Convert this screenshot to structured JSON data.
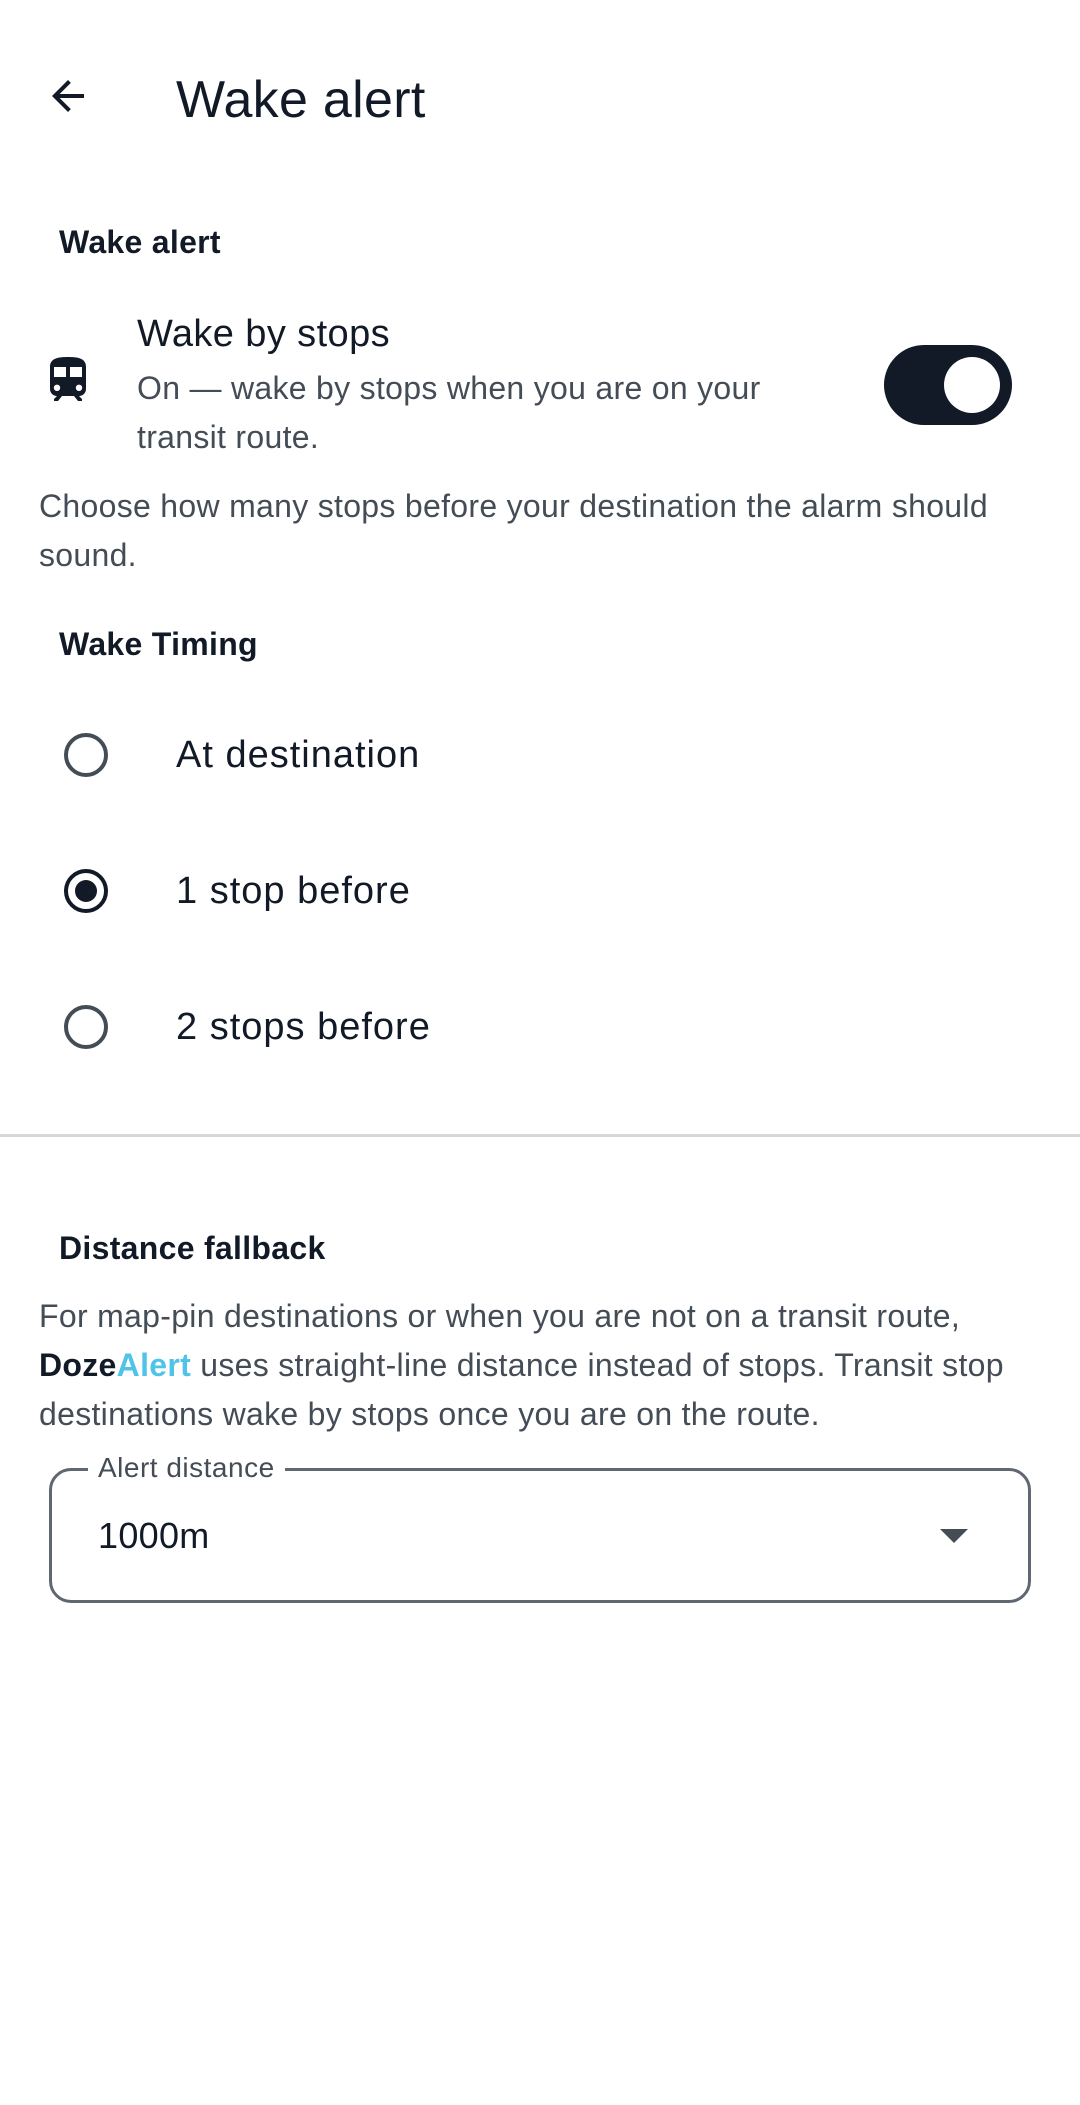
{
  "appbar": {
    "back_icon": "arrow-back-icon",
    "title": "Wake alert"
  },
  "wake_alert_section": {
    "header": "Wake alert",
    "switch": {
      "icon": "train-icon",
      "title": "Wake by stops",
      "subtitle": "On — wake by stops when you are on your transit route.",
      "checked": true
    },
    "helper": "Choose how many stops before your destination the alarm should sound."
  },
  "wake_timing": {
    "header": "Wake Timing",
    "options": [
      {
        "label": "At destination",
        "selected": false
      },
      {
        "label": "1 stop before",
        "selected": true
      },
      {
        "label": "2 stops before",
        "selected": false
      }
    ]
  },
  "distance_fallback": {
    "header": "Distance fallback",
    "text_before": "For map-pin destinations or when you are not on a transit route, ",
    "brand_part1": "Doze",
    "brand_part2": "Alert",
    "text_after": " uses straight-line distance instead of stops. Transit stop destinations wake by stops once you are on the route.",
    "dropdown": {
      "label": "Alert distance",
      "value": "1000m",
      "icon": "dropdown-arrow-icon"
    }
  },
  "colors": {
    "primary": "#111a26",
    "secondary_text": "#444c56",
    "brand_accent": "#4fc3e8",
    "divider": "#d5d7da"
  }
}
